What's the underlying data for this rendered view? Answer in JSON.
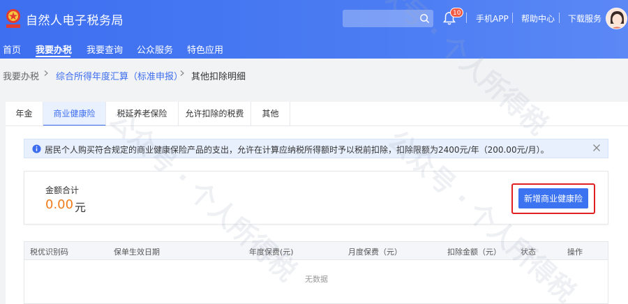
{
  "header": {
    "title": "自然人电子税务局",
    "notification_count": "10",
    "links": [
      "手机APP",
      "帮助中心",
      "下载服务"
    ]
  },
  "nav": {
    "items": [
      "首页",
      "我要办税",
      "我要查询",
      "公众服务",
      "特色应用"
    ],
    "active": "我要办税"
  },
  "breadcrumb": {
    "items": [
      "我要办税",
      "综合所得年度汇算（标准申报）",
      "其他扣除明细"
    ]
  },
  "tabs": [
    "年金",
    "商业健康险",
    "税延养老保险",
    "允许扣除的税费",
    "其他"
  ],
  "active_tab": "商业健康险",
  "notice": {
    "text": "居民个人购买符合规定的商业健康保险产品的支出，允许在计算应纳税所得额时予以税前扣除，扣除限额为2400元/年（200.00元/月）。"
  },
  "total": {
    "label": "金额合计",
    "amount": "0.00",
    "unit": "元"
  },
  "add_button": "新增商业健康险",
  "table": {
    "columns": [
      "税优识别码",
      "保单生效日期",
      "年度保费(元)",
      "月度保费（元）",
      "扣除金额（元）",
      "状态",
      "操作"
    ],
    "empty_text": "无数据"
  },
  "watermark": "公众号 · 个人所得税",
  "colors": {
    "brand_blue": "#3d6ff0",
    "amount_orange": "#f07c1c",
    "highlight_red": "#e02020"
  }
}
